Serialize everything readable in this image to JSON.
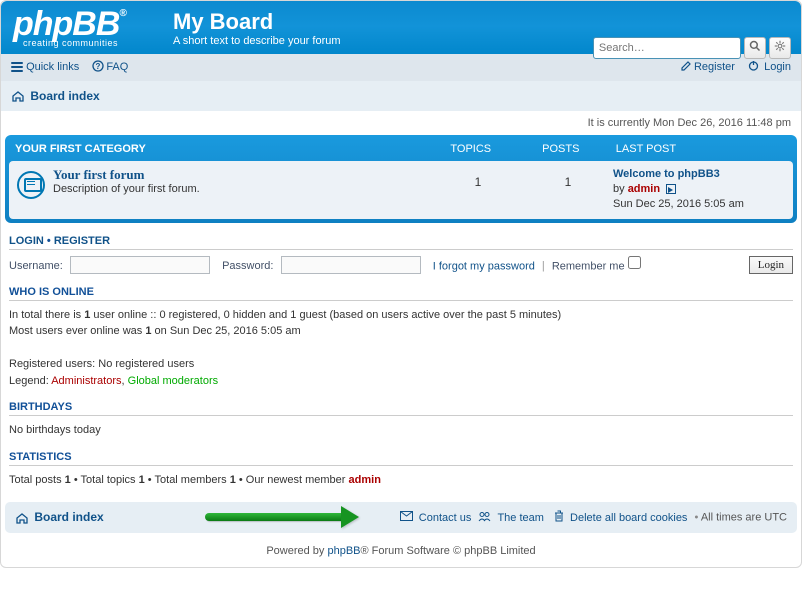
{
  "header": {
    "logo_top": "phpBB",
    "logo_reg": "®",
    "logo_sub": "creating   communities",
    "title": "My Board",
    "desc": "A short text to describe your forum"
  },
  "search": {
    "placeholder": "Search…"
  },
  "nav": {
    "quick_links": "Quick links",
    "faq": "FAQ",
    "register": "Register",
    "login": "Login"
  },
  "breadcrumb": {
    "board_index": "Board index"
  },
  "time_now": "It is currently Mon Dec 26, 2016 11:48 pm",
  "category": {
    "name": "YOUR FIRST CATEGORY",
    "col_topics": "TOPICS",
    "col_posts": "POSTS",
    "col_last": "LAST POST",
    "forum": {
      "title": "Your first forum",
      "desc": "Description of your first forum.",
      "topics": "1",
      "posts": "1",
      "last_title": "Welcome to phpBB3",
      "last_by_label": "by ",
      "last_by": "admin",
      "last_time": "Sun Dec 25, 2016 5:05 am"
    }
  },
  "login": {
    "heading_login": "LOGIN",
    "heading_register": "REGISTER",
    "sep": "  •  ",
    "username_label": "Username:",
    "password_label": "Password:",
    "forgot": "I forgot my password",
    "remember": "Remember me",
    "button": "Login"
  },
  "who": {
    "heading": "WHO IS ONLINE",
    "line1a": "In total there is ",
    "line1b": "1",
    "line1c": " user online :: 0 registered, 0 hidden and 1 guest (based on users active over the past 5 minutes)",
    "line2a": "Most users ever online was ",
    "line2b": "1",
    "line2c": " on Sun Dec 25, 2016 5:05 am",
    "reg_users": "Registered users: No registered users",
    "legend_label": "Legend: ",
    "admins": "Administrators",
    "comma": ", ",
    "mods": "Global moderators"
  },
  "birthdays": {
    "heading": "BIRTHDAYS",
    "text": "No birthdays today"
  },
  "stats": {
    "heading": "STATISTICS",
    "t1": "Total posts ",
    "v1": "1",
    "t2": " • Total topics ",
    "v2": "1",
    "t3": " • Total members ",
    "v3": "1",
    "t4": " • Our newest member ",
    "newest": "admin"
  },
  "footer": {
    "board_index": "Board index",
    "contact": "Contact us",
    "team": "The team",
    "cookies": "Delete all board cookies",
    "tz": "All times are UTC"
  },
  "credits": {
    "a": "Powered by ",
    "b": "phpBB",
    "c": "® Forum Software © phpBB Limited"
  }
}
